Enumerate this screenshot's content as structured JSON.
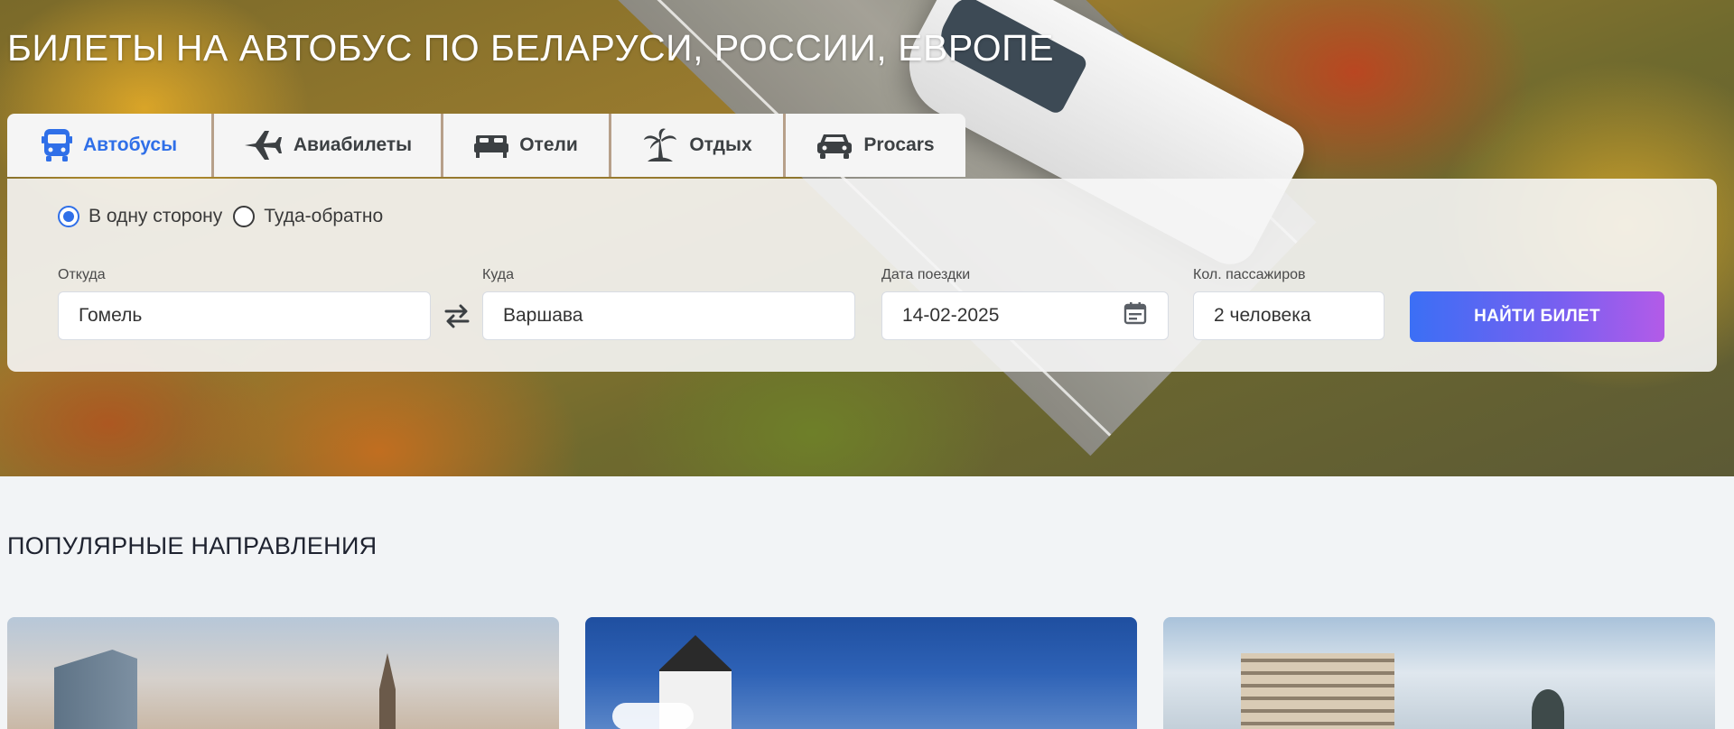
{
  "hero": {
    "title": "БИЛЕТЫ НА АВТОБУС ПО БЕЛАРУСИ, РОССИИ, ЕВРОПЕ"
  },
  "tabs": [
    {
      "label": "Автобусы",
      "icon": "bus-icon",
      "active": true
    },
    {
      "label": "Авиабилеты",
      "icon": "airplane-icon",
      "active": false
    },
    {
      "label": "Отели",
      "icon": "bed-icon",
      "active": false
    },
    {
      "label": "Отдых",
      "icon": "palm-tree-icon",
      "active": false
    },
    {
      "label": "Procars",
      "icon": "car-icon",
      "active": false
    }
  ],
  "search": {
    "trip_type": {
      "one_way": "В одну сторону",
      "round_trip": "Туда-обратно",
      "selected": "one_way"
    },
    "from": {
      "label": "Откуда",
      "value": "Гомель"
    },
    "to": {
      "label": "Куда",
      "value": "Варшава"
    },
    "date": {
      "label": "Дата поездки",
      "value": "14-02-2025"
    },
    "passengers": {
      "label": "Кол. пассажиров",
      "value": "2 человека"
    },
    "submit_label": "НАЙТИ БИЛЕТ"
  },
  "popular": {
    "title": "ПОПУЛЯРНЫЕ НАПРАВЛЕНИЯ"
  },
  "colors": {
    "accent": "#2f6fe8",
    "button_gradient_start": "#3b6ff5",
    "button_gradient_end": "#b35be8"
  }
}
